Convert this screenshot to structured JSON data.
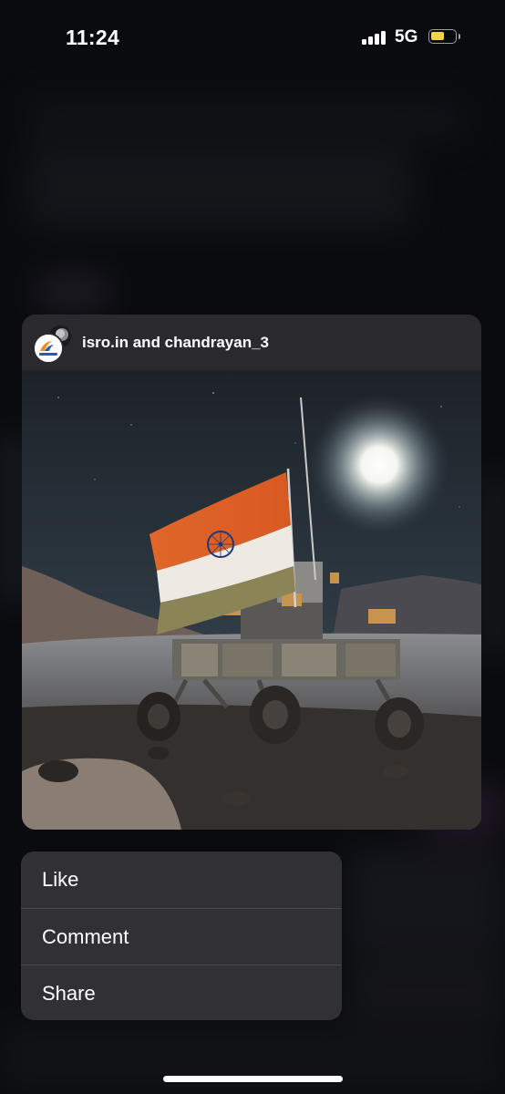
{
  "status_bar": {
    "time": "11:24",
    "network": "5G",
    "icons": [
      "signal-icon",
      "battery-icon"
    ],
    "battery_color": "#f1d547"
  },
  "post": {
    "username": "isro.in and chandrayan_3",
    "avatars": [
      "isro-logo-avatar",
      "chandrayaan-avatar"
    ],
    "image_subject": "moon-rover-with-indian-flag"
  },
  "menu": {
    "items": [
      {
        "label": "Like"
      },
      {
        "label": "Comment"
      },
      {
        "label": "Share"
      }
    ]
  }
}
